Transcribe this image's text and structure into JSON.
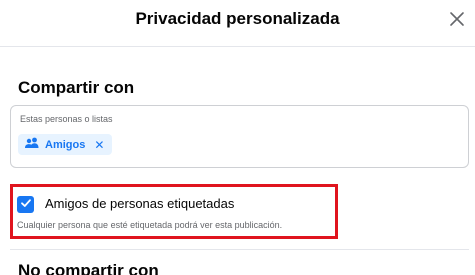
{
  "dialog": {
    "title": "Privacidad personalizada",
    "close_icon": "close-icon"
  },
  "share_with": {
    "heading": "Compartir con",
    "field_label": "Estas personas o listas",
    "chip": {
      "label": "Amigos",
      "icon": "friends-icon",
      "remove_symbol": "✕"
    }
  },
  "tagged_friends": {
    "checked": true,
    "label": "Amigos de personas etiquetadas",
    "description": "Cualquier persona que esté etiquetada podrá ver esta publicación."
  },
  "dont_share_with": {
    "heading": "No compartir con"
  },
  "colors": {
    "accent": "#1877f2",
    "chip_bg": "#e7f3ff",
    "highlight_border": "#e0141e",
    "secondary_text": "#65676b"
  }
}
